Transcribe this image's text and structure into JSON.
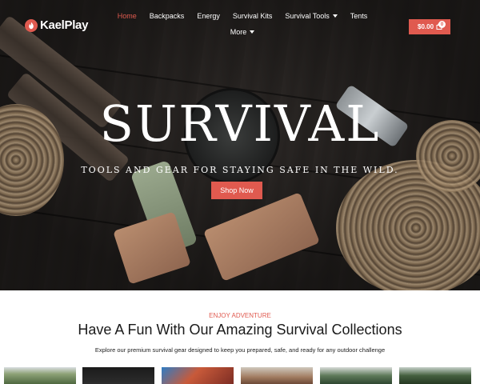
{
  "brand": {
    "name": "KaelPlay"
  },
  "nav": {
    "items": [
      {
        "label": "Home",
        "active": true,
        "has_dropdown": false
      },
      {
        "label": "Backpacks",
        "active": false,
        "has_dropdown": false
      },
      {
        "label": "Energy",
        "active": false,
        "has_dropdown": false
      },
      {
        "label": "Survival Kits",
        "active": false,
        "has_dropdown": false
      },
      {
        "label": "Survival Tools",
        "active": false,
        "has_dropdown": true
      },
      {
        "label": "Tents",
        "active": false,
        "has_dropdown": false
      }
    ],
    "more_label": "More"
  },
  "cart": {
    "total": "$0.00",
    "count": "0"
  },
  "hero": {
    "title": "SURVIVAL",
    "subtitle": "TOOLS AND GEAR FOR STAYING SAFE IN THE WILD.",
    "cta_label": "Shop Now"
  },
  "section": {
    "eyebrow": "ENJOY ADVENTURE",
    "title": "Have A Fun With Our Amazing Survival Collections",
    "description": "Explore our premium survival gear designed to keep you prepared, safe, and ready for any outdoor challenge"
  },
  "colors": {
    "accent": "#e05a4f",
    "hero_bg": "#2c2826",
    "text_dark": "#1a1a1a"
  },
  "icons": {
    "logo": "flame-logo-icon",
    "cart": "shopping-bag-icon",
    "dropdown": "chevron-down-icon"
  }
}
